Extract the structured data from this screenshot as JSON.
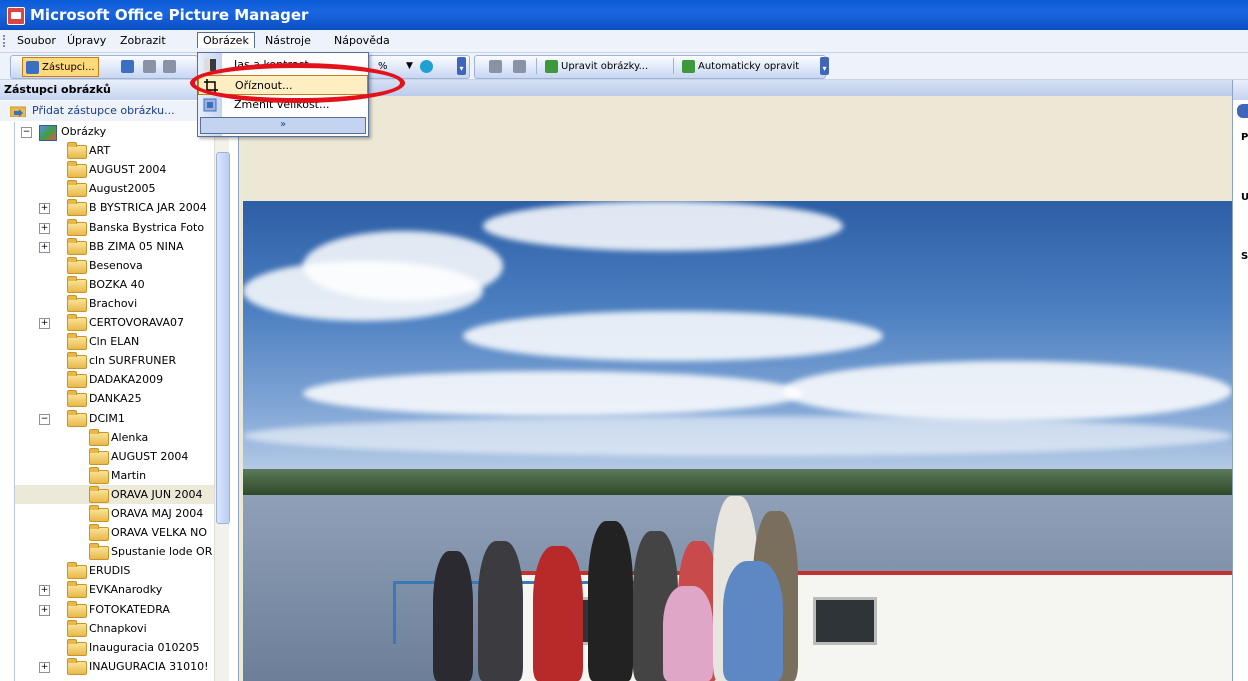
{
  "window": {
    "title": "Microsoft Office Picture Manager"
  },
  "menubar": {
    "items": [
      {
        "label": "Soubor",
        "key": "soubor"
      },
      {
        "label": "Úpravy",
        "key": "upravy"
      },
      {
        "label": "Zobrazit",
        "key": "zobrazit"
      },
      {
        "label": "Obrázek",
        "key": "obrazek",
        "active": true
      },
      {
        "label": "Nástroje",
        "key": "nastroje"
      },
      {
        "label": "Nápověda",
        "key": "napoveda"
      }
    ]
  },
  "toolbar": {
    "zastupci_label": "Zástupci...",
    "zoom_value": "%",
    "edit_label": "Upravit obrázky...",
    "autofix_label": "Automaticky opravit"
  },
  "left_pane": {
    "header": "Zástupci obrázků",
    "add_link": "Přidat zástupce obrázku...",
    "root": "Obrázky",
    "folders": [
      {
        "label": "ART",
        "depth": 1,
        "expander": ""
      },
      {
        "label": "AUGUST 2004",
        "depth": 1,
        "expander": ""
      },
      {
        "label": "August2005",
        "depth": 1,
        "expander": ""
      },
      {
        "label": "B BYSTRICA JAR 2004",
        "depth": 1,
        "expander": "+"
      },
      {
        "label": "Banska Bystrica Foto",
        "depth": 1,
        "expander": "+"
      },
      {
        "label": "BB ZIMA 05 NINA",
        "depth": 1,
        "expander": "+"
      },
      {
        "label": "Besenova",
        "depth": 1,
        "expander": ""
      },
      {
        "label": "BOZKA 40",
        "depth": 1,
        "expander": ""
      },
      {
        "label": "Brachovi",
        "depth": 1,
        "expander": ""
      },
      {
        "label": "CERTOVORAVA07",
        "depth": 1,
        "expander": "+"
      },
      {
        "label": "Cln ELAN",
        "depth": 1,
        "expander": ""
      },
      {
        "label": "cln SURFRUNER",
        "depth": 1,
        "expander": ""
      },
      {
        "label": "DADAKA2009",
        "depth": 1,
        "expander": ""
      },
      {
        "label": "DANKA25",
        "depth": 1,
        "expander": ""
      },
      {
        "label": "DCIM1",
        "depth": 1,
        "expander": "−"
      },
      {
        "label": "Alenka",
        "depth": 2,
        "expander": ""
      },
      {
        "label": "AUGUST 2004",
        "depth": 2,
        "expander": ""
      },
      {
        "label": "Martin",
        "depth": 2,
        "expander": ""
      },
      {
        "label": "ORAVA JUN 2004",
        "depth": 2,
        "expander": "",
        "selected": true
      },
      {
        "label": "ORAVA MAJ 2004",
        "depth": 2,
        "expander": ""
      },
      {
        "label": "ORAVA VELKA NO",
        "depth": 2,
        "expander": ""
      },
      {
        "label": "Spustanie lode OR",
        "depth": 2,
        "expander": ""
      },
      {
        "label": "ERUDIS",
        "depth": 1,
        "expander": ""
      },
      {
        "label": "EVKAnarodky",
        "depth": 1,
        "expander": "+"
      },
      {
        "label": "FOTOKATEDRA",
        "depth": 1,
        "expander": "+"
      },
      {
        "label": "Chnapkovi",
        "depth": 1,
        "expander": ""
      },
      {
        "label": "Inauguracia 010205",
        "depth": 1,
        "expander": ""
      },
      {
        "label": "INAUGURACIA 31010!",
        "depth": 1,
        "expander": "+"
      }
    ]
  },
  "dropdown": {
    "items": [
      {
        "label": "Jas a kontrast...",
        "icon": "brightness-icon"
      },
      {
        "label": "Oříznout...",
        "icon": "crop-icon",
        "hover": true
      },
      {
        "label": "Změnit velikost...",
        "icon": "resize-icon"
      }
    ],
    "more": "»"
  },
  "right_pane": {
    "letters": [
      "P",
      "U",
      "S"
    ]
  },
  "annotation": {
    "color": "#e3121a"
  },
  "colors": {
    "title_bar": "#0a5bd8",
    "selection": "#ece9d8",
    "menu_hover": "#ffeec2"
  }
}
